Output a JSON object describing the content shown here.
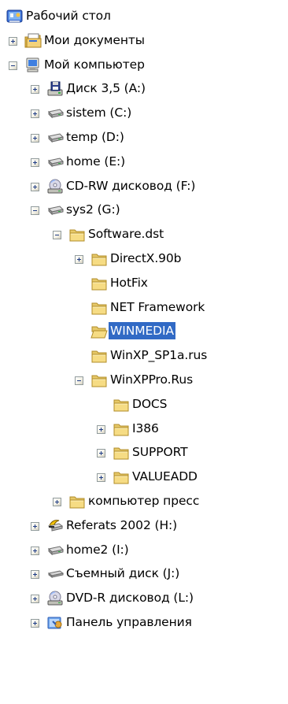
{
  "tree": {
    "selected_color": "#316ac5",
    "items": [
      {
        "label": "Рабочий стол",
        "icon": "desktop-icon",
        "level": 0,
        "toggle": "none",
        "selected": false
      },
      {
        "label": "Мои документы",
        "icon": "my-documents-icon",
        "level": 1,
        "toggle": "plus",
        "selected": false
      },
      {
        "label": "Мой компьютер",
        "icon": "my-computer-icon",
        "level": 1,
        "toggle": "minus",
        "selected": false
      },
      {
        "label": "Диск 3,5 (A:)",
        "icon": "floppy-drive-icon",
        "level": 2,
        "toggle": "plus",
        "selected": false
      },
      {
        "label": "sistem (C:)",
        "icon": "hard-drive-icon",
        "level": 2,
        "toggle": "plus",
        "selected": false
      },
      {
        "label": "temp (D:)",
        "icon": "hard-drive-icon",
        "level": 2,
        "toggle": "plus",
        "selected": false
      },
      {
        "label": "home (E:)",
        "icon": "hard-drive-icon",
        "level": 2,
        "toggle": "plus",
        "selected": false
      },
      {
        "label": "CD-RW дисковод (F:)",
        "icon": "cd-drive-icon",
        "level": 2,
        "toggle": "plus",
        "selected": false
      },
      {
        "label": "sys2 (G:)",
        "icon": "hard-drive-icon",
        "level": 2,
        "toggle": "minus",
        "selected": false
      },
      {
        "label": "Software.dst",
        "icon": "folder-icon",
        "level": 3,
        "toggle": "minus",
        "selected": false
      },
      {
        "label": "DirectX.90b",
        "icon": "folder-icon",
        "level": 4,
        "toggle": "plus",
        "selected": false
      },
      {
        "label": "HotFix",
        "icon": "folder-icon",
        "level": 4,
        "toggle": "none",
        "selected": false
      },
      {
        "label": "NET Framework",
        "icon": "folder-icon",
        "level": 4,
        "toggle": "none",
        "selected": false
      },
      {
        "label": "WINMEDIA",
        "icon": "folder-open-icon",
        "level": 4,
        "toggle": "none",
        "selected": true
      },
      {
        "label": "WinXP_SP1a.rus",
        "icon": "folder-icon",
        "level": 4,
        "toggle": "none",
        "selected": false
      },
      {
        "label": "WinXPPro.Rus",
        "icon": "folder-icon",
        "level": 4,
        "toggle": "minus",
        "selected": false
      },
      {
        "label": "DOCS",
        "icon": "folder-icon",
        "level": 5,
        "toggle": "none",
        "selected": false
      },
      {
        "label": "I386",
        "icon": "folder-icon",
        "level": 5,
        "toggle": "plus",
        "selected": false
      },
      {
        "label": "SUPPORT",
        "icon": "folder-icon",
        "level": 5,
        "toggle": "plus",
        "selected": false
      },
      {
        "label": "VALUEADD",
        "icon": "folder-icon",
        "level": 5,
        "toggle": "plus",
        "selected": false
      },
      {
        "label": "компьютер пресс",
        "icon": "folder-icon",
        "level": 3,
        "toggle": "plus",
        "selected": false
      },
      {
        "label": "Referats 2002 (H:)",
        "icon": "network-drive-icon",
        "level": 2,
        "toggle": "plus",
        "selected": false
      },
      {
        "label": "home2 (I:)",
        "icon": "hard-drive-icon",
        "level": 2,
        "toggle": "plus",
        "selected": false
      },
      {
        "label": "Съемный диск (J:)",
        "icon": "removable-drive-icon",
        "level": 2,
        "toggle": "plus",
        "selected": false
      },
      {
        "label": "DVD-R дисковод (L:)",
        "icon": "cd-drive-icon",
        "level": 2,
        "toggle": "plus",
        "selected": false
      },
      {
        "label": "Панель управления",
        "icon": "control-panel-icon",
        "level": 2,
        "toggle": "plus",
        "selected": false
      }
    ]
  }
}
